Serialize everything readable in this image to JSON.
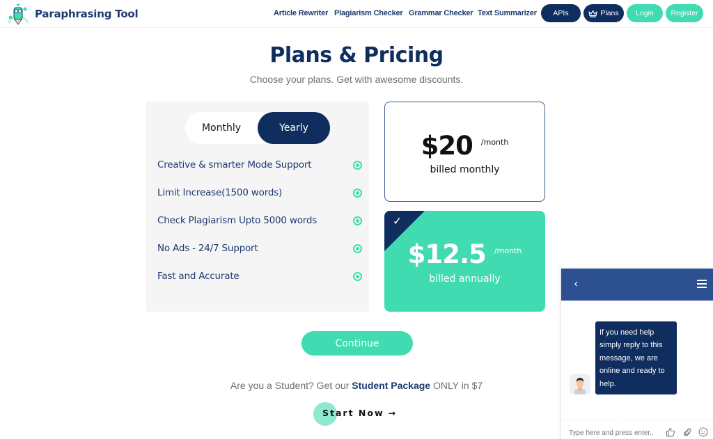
{
  "header": {
    "brand": "Paraphrasing Tool",
    "nav": [
      "Article Rewriter",
      "Plagiarism Checker",
      "Grammar Checker",
      "Text Summarizer"
    ],
    "apis_label": "APIs",
    "plans_label": "Plans",
    "login_label": "Login",
    "register_label": "Register"
  },
  "page": {
    "title": "Plans & Pricing",
    "subtitle": "Choose your plans. Get with awesome discounts."
  },
  "billing_toggle": {
    "options": [
      "Monthly",
      "Yearly"
    ],
    "selected": "Yearly"
  },
  "features": [
    "Creative & smarter Mode Support",
    "Limit Increase(1500 words)",
    "Check Plagiarism Upto 5000 words",
    "No Ads - 24/7 Support",
    "Fast and Accurate"
  ],
  "plans": {
    "monthly": {
      "price": "$20",
      "period": "/month",
      "billed": "billed monthly",
      "selected": false
    },
    "annual": {
      "price": "$12.5",
      "period": "/month",
      "billed": "billed annually",
      "selected": true,
      "check": "✓"
    }
  },
  "continue_label": "Continue",
  "student": {
    "prefix": "Are you a Student? Get our",
    "highlight": "Student Package",
    "suffix": "ONLY in $7",
    "cta": "Start Now",
    "cta_arrow": "→"
  },
  "chat": {
    "back_icon": "‹",
    "message": "If you need help simply reply to this message, we are online and ready to help.",
    "input_placeholder": "Type here and press enter.."
  },
  "colors": {
    "navy": "#0f2d5e",
    "accent_green": "#40dbb1",
    "chat_header": "#2c5090"
  }
}
